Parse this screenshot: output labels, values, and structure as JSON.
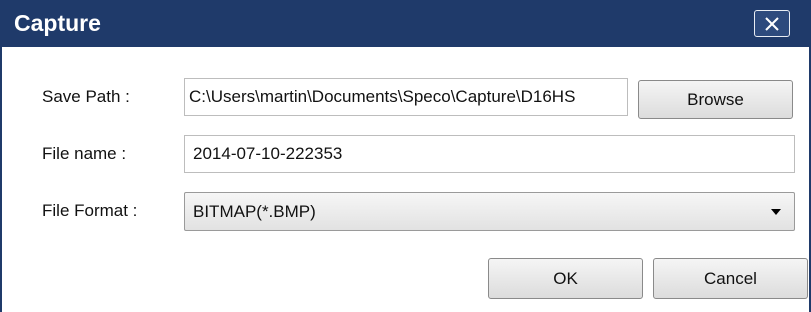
{
  "window": {
    "title": "Capture",
    "close_icon": "close-icon"
  },
  "form": {
    "save_path_label": "Save Path :",
    "save_path_value": "C:\\Users\\martin\\Documents\\Speco\\Capture\\D16HS",
    "file_name_label": "File name :",
    "file_name_value": "2014-07-10-222353",
    "file_format_label": "File Format :",
    "file_format_value": "BITMAP(*.BMP)"
  },
  "buttons": {
    "browse": "Browse",
    "ok": "OK",
    "cancel": "Cancel"
  },
  "colors": {
    "titlebar": "#1f3a6a",
    "title_text": "#ffffff"
  }
}
